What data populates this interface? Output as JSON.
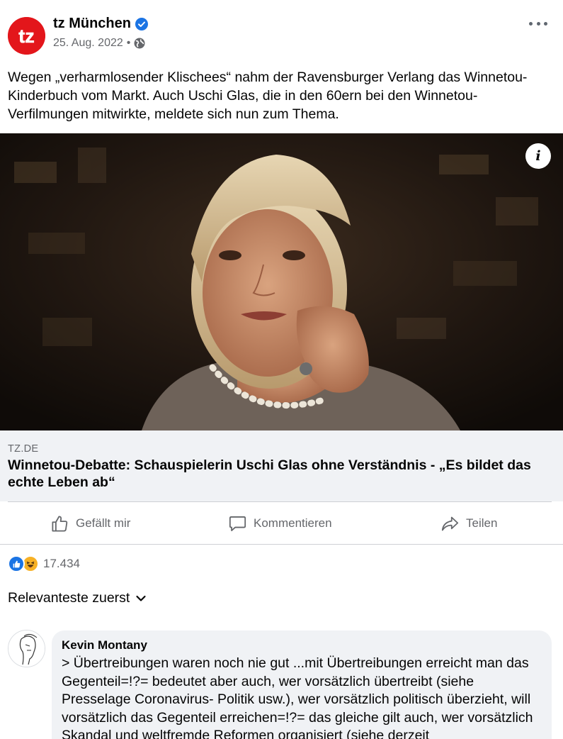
{
  "post": {
    "page_name": "tz München",
    "date": "25. Aug. 2022",
    "separator": "•",
    "text": "Wegen „verharmlosender Klischees“ nahm der Ravensburger Verlang das Winnetou-Kinderbuch vom Markt. Auch Uschi Glas, die in den 60ern bei den Winnetou-Verfilmungen mitwirkte, meldete sich nun zum Thema.",
    "logo_text": "tz",
    "icons": [
      "verified-icon",
      "globe-icon",
      "more-icon",
      "info-icon"
    ]
  },
  "link_card": {
    "domain": "TZ.DE",
    "title": "Winnetou-Debatte: Schauspielerin Uschi Glas ohne Verständnis - „Es bildet das echte Leben ab“"
  },
  "actions": {
    "like_label": "Gefällt mir",
    "comment_label": "Kommentieren",
    "share_label": "Teilen"
  },
  "reactions": {
    "count": "17.434",
    "types": [
      "like",
      "haha"
    ]
  },
  "sort": {
    "label": "Relevanteste zuerst"
  },
  "comments": [
    {
      "author": "Kevin Montany",
      "text": "> Übertreibungen waren noch nie gut ...mit Übertreibungen erreicht man das Gegenteil=!?= bedeutet aber auch, wer vorsätzlich übertreibt (siehe Presselage Coronavirus- Politik usw.), wer vorsätzlich politisch überzieht, will vorsätzlich das Gegenteil erreichen=!?= das gleiche gilt auch, wer vorsätzlich Skandal und weltfremde Reformen organisiert (siehe derzeit"
    }
  ],
  "colors": {
    "brand_red": "#e3161b",
    "facebook_blue": "#1b74e4",
    "secondary_text": "#65676b",
    "card_background": "#f0f2f5"
  }
}
